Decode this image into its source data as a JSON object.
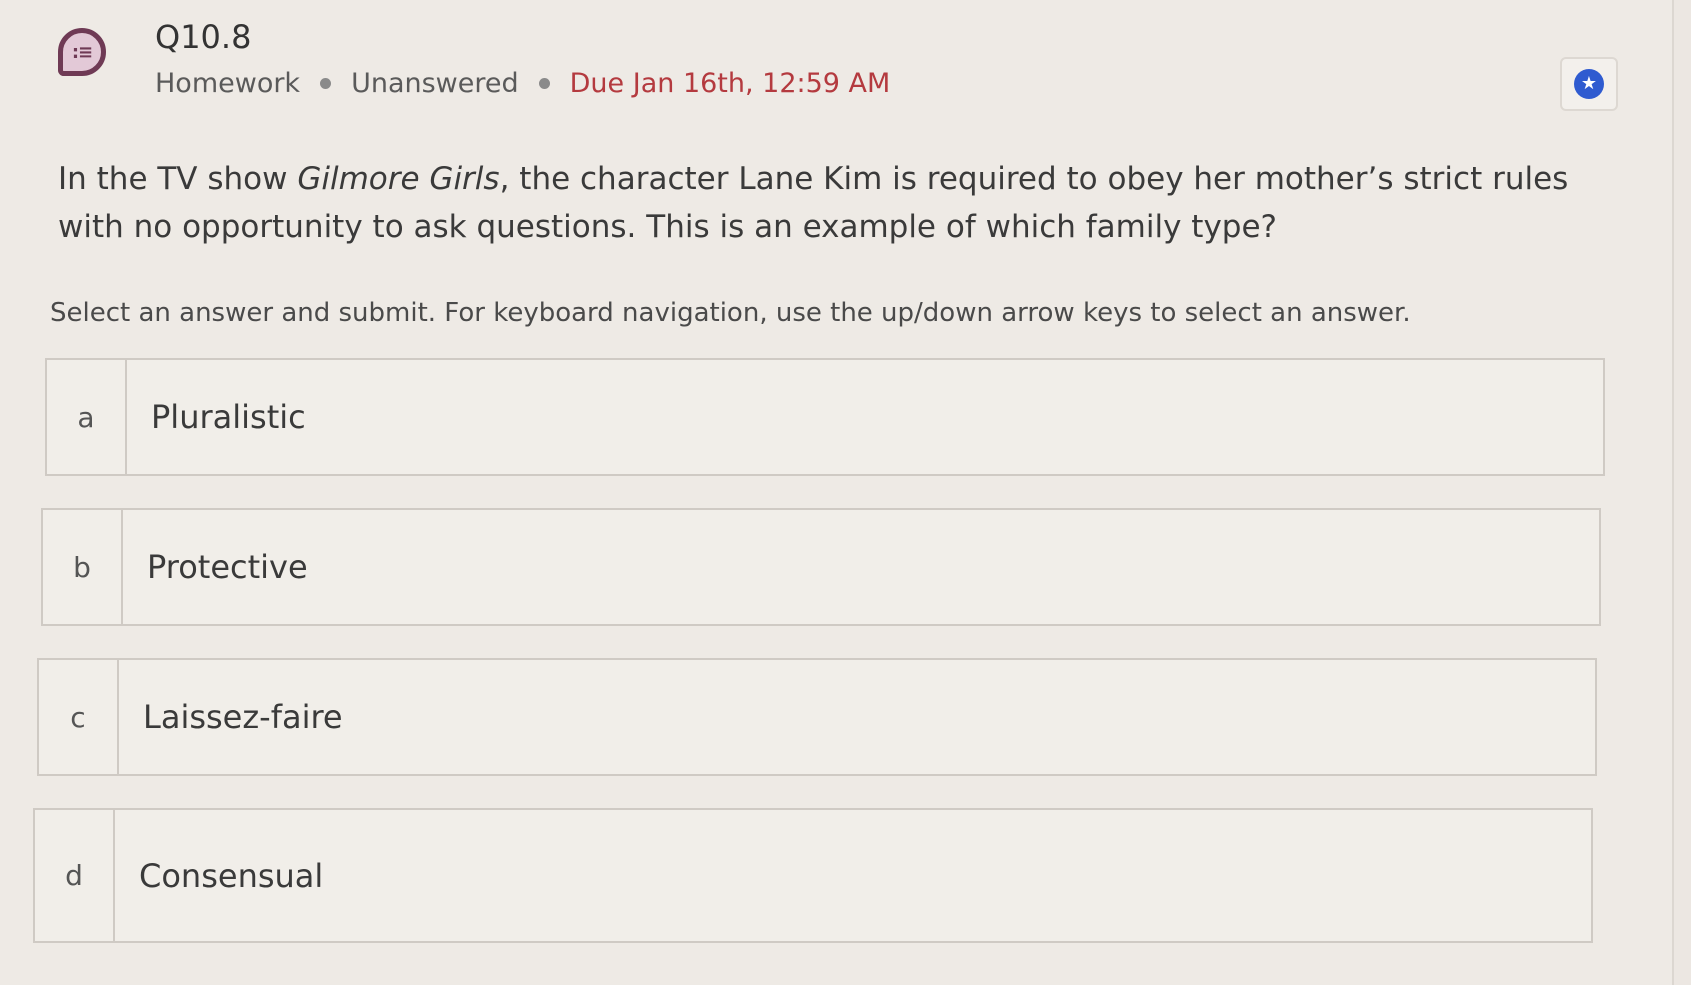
{
  "question": {
    "number": "Q10.8",
    "icon": "list-chat-icon",
    "meta": {
      "type": "Homework",
      "status": "Unanswered",
      "due": "Due Jan 16th, 12:59 AM"
    },
    "text_before": "In the TV show ",
    "text_italic": "Gilmore Girls",
    "text_after": ", the character Lane Kim is required to obey her mother’s strict rules with no opportunity to ask questions. This is an example of which family type?",
    "instructions": "Select an answer and submit. For keyboard navigation, use the up/down arrow keys to select an answer.",
    "bookmark_icon": "star-icon"
  },
  "options": [
    {
      "letter": "a",
      "label": "Pluralistic"
    },
    {
      "letter": "b",
      "label": "Protective"
    },
    {
      "letter": "c",
      "label": "Laissez-faire"
    },
    {
      "letter": "d",
      "label": "Consensual"
    }
  ],
  "colors": {
    "due": "#b43a3f",
    "accent": "#2f5bd0",
    "icon": "#6f3a55"
  }
}
